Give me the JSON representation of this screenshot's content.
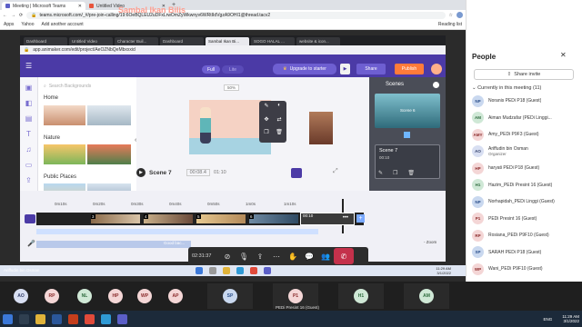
{
  "browser": {
    "tabs": [
      {
        "label": "Meeting | Microsoft Teams",
        "active": true
      },
      {
        "label": "Untitled Video",
        "active": false
      }
    ],
    "url": "teams.microsoft.com/_#/pre-join-calling/19:6OeBQLEU2uDFxLrwOmZyWkwnyv6WRtIIdVgzA9OHI1@thread.tacv2",
    "bookmarks": [
      "Apps",
      "Yahoo",
      "Add another account"
    ],
    "reading_list": "Reading list"
  },
  "shared": {
    "tabs": [
      "Dashboard",
      "Untitled Video",
      "Character Buil...",
      "Dashboard",
      "Sambal Ikan Bi...",
      "SOGO HALAL ...",
      "website & icon..."
    ],
    "url": "app.animaker.com/edit/project/AeOZNbQeMbxxxid",
    "project_title": "Sambal Ikan Bilis",
    "full_label": "Full",
    "lite_label": "Lite",
    "upgrade_label": "Upgrade to starter",
    "share_label": "Share",
    "publish_label": "Publish",
    "search_placeholder": "Search Backgrounds",
    "categories": [
      "Home",
      "Nature",
      "Public Places"
    ],
    "zoom_pct": "50%",
    "scene_label": "Scene 7",
    "time_current": "00:08.4",
    "time_total": "01:10",
    "scenes_title": "Scenes",
    "scene6_label": "Scene 6",
    "scene7_label": "Scene 7",
    "scene7_duration": "00:10",
    "ruler": [
      "0m10s",
      "0m20s",
      "0m30s",
      "0m40s",
      "0m50s",
      "1m0s",
      "1m10s"
    ],
    "track_nums": [
      "3",
      "4",
      "5",
      "6"
    ],
    "track_time": "00:10",
    "bg_label": "Good bac...",
    "zoom_label": "Zoom"
  },
  "callbar": {
    "timer": "02:31:37"
  },
  "presenter_caption": "Ariffudin bin Osman",
  "people": {
    "title": "People",
    "share_invite": "Share invite",
    "current_label": "Currently in this meeting (11)",
    "list": [
      {
        "initials": "NP",
        "name": "Noranis PEDi P18 (Guest)",
        "color": "#c9d8ef",
        "fg": "#2b4f8a"
      },
      {
        "initials": "AM",
        "name": "Aiman Mudzafar (PEDi Linggi...",
        "color": "#cfe8d6",
        "fg": "#2e6b3e"
      },
      {
        "initials": "AMY",
        "name": "Amy_PEDi P9F3 (Guest)",
        "color": "#f4d6d6",
        "fg": "#8a2b2b"
      },
      {
        "initials": "AO",
        "name": "Ariffudin bin Osman",
        "role": "Organizer",
        "color": "#d8dff2",
        "fg": "#34406b"
      },
      {
        "initials": "HP",
        "name": "haryati PEDi P18 (Guest)",
        "color": "#f4d6d6",
        "fg": "#8a2b2b"
      },
      {
        "initials": "H1",
        "name": "Hazim_PEDi Presint 16 (Guest)",
        "color": "#cfe8d6",
        "fg": "#2e6b3e"
      },
      {
        "initials": "NP",
        "name": "Norhapidah_PEDi Linggi (Guest)",
        "color": "#c9d8ef",
        "fg": "#2b4f8a"
      },
      {
        "initials": "P1",
        "name": "PEDi Presint 16 (Guest)",
        "color": "#f4d6d6",
        "fg": "#8a2b2b"
      },
      {
        "initials": "RP",
        "name": "Rosiana_PEDi P9F10 (Guest)",
        "color": "#f4d6d6",
        "fg": "#8a2b2b"
      },
      {
        "initials": "SP",
        "name": "SARAH PEDi P18 (Guest)",
        "color": "#c9d8ef",
        "fg": "#2b4f8a"
      },
      {
        "initials": "WP",
        "name": "Wani_PEDi P9F10 (Guest)",
        "color": "#f4d6d6",
        "fg": "#8a2b2b"
      }
    ]
  },
  "gallery": [
    {
      "initials": "AO",
      "color": "#d8dff2",
      "fg": "#34406b"
    },
    {
      "initials": "RP",
      "color": "#f4d6d6",
      "fg": "#8a2b2b"
    },
    {
      "initials": "NL",
      "color": "#cfe8d6",
      "fg": "#2e6b3e"
    },
    {
      "initials": "HP",
      "color": "#f4d6d6",
      "fg": "#8a2b2b"
    },
    {
      "initials": "WP",
      "color": "#f4d6d6",
      "fg": "#8a2b2b"
    },
    {
      "initials": "AP",
      "color": "#f4d6d6",
      "fg": "#8a2b2b"
    },
    {
      "initials": "SP",
      "color": "#c9d8ef",
      "fg": "#2b4f8a"
    },
    {
      "initials": "P1",
      "color": "#f4d6d6",
      "fg": "#8a2b2b"
    },
    {
      "initials": "H1",
      "color": "#cfe8d6",
      "fg": "#2e6b3e"
    },
    {
      "initials": "AM",
      "color": "#cfe8d6",
      "fg": "#2e6b3e"
    }
  ],
  "gallery_caption": "PEDi Presint 16 (Guest)",
  "taskbar": {
    "inner_clock_time": "11:29 AM",
    "inner_clock_date": "3/1/2022",
    "clock_time": "11:29 AM",
    "clock_date": "3/1/2022",
    "lang": "ENG"
  }
}
